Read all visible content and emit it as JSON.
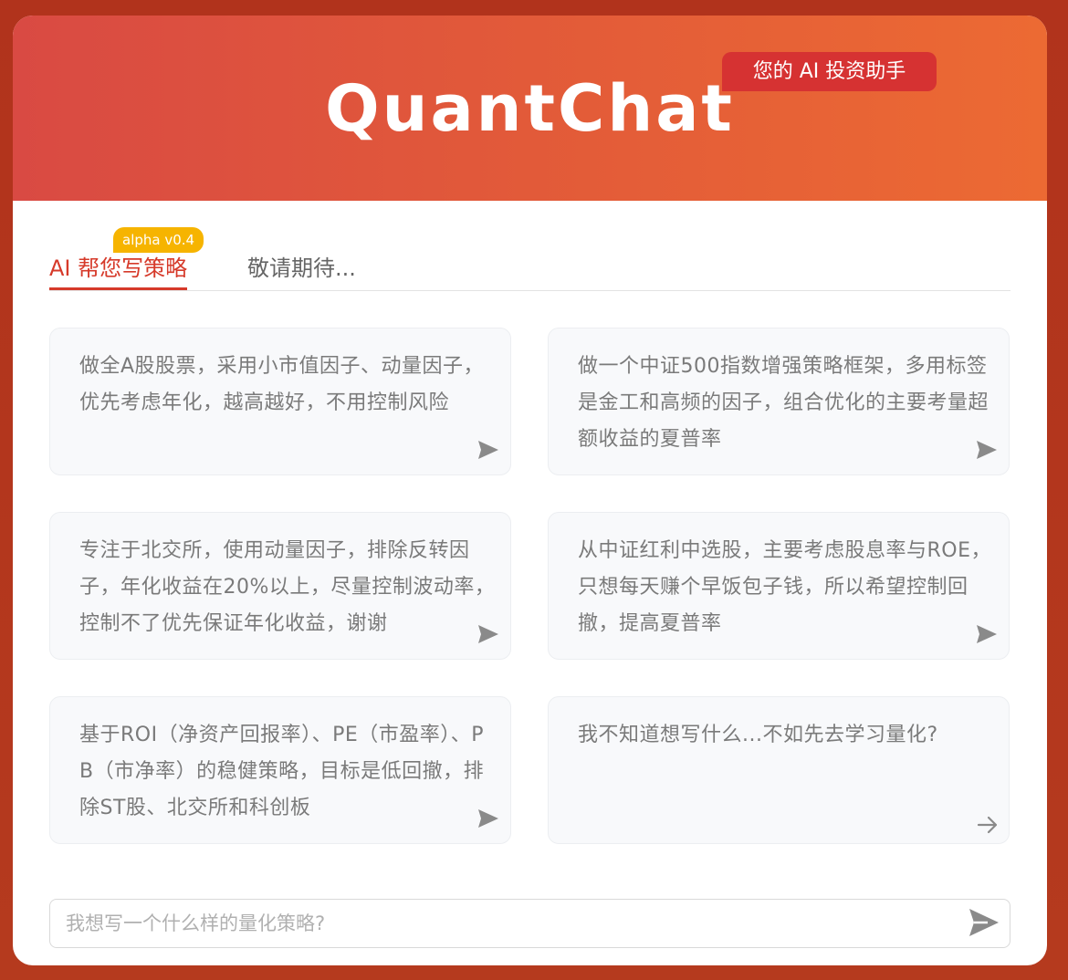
{
  "header": {
    "title": "QuantChat",
    "tagline": "您的 AI 投资助手"
  },
  "tabs": [
    {
      "label": "AI 帮您写策略",
      "badge": "alpha v0.4",
      "active": true
    },
    {
      "label": "敬请期待...",
      "active": false
    }
  ],
  "prompts": [
    {
      "text": "做全A股股票，采用小市值因子、动量因子，优先考虑年化，越高越好，不用控制风险",
      "icon": "send-icon"
    },
    {
      "text": "做一个中证500指数增强策略框架，多用标签是金工和高频的因子，组合优化的主要考量超额收益的夏普率",
      "icon": "send-icon"
    },
    {
      "text": "专注于北交所，使用动量因子，排除反转因子，年化收益在20%以上，尽量控制波动率，控制不了优先保证年化收益，谢谢",
      "icon": "send-icon"
    },
    {
      "text": "从中证红利中选股，主要考虑股息率与ROE，只想每天赚个早饭包子钱，所以希望控制回撤，提高夏普率",
      "icon": "send-icon"
    },
    {
      "text": "基于ROI（净资产回报率）、PE（市盈率）、PB（市净率）的稳健策略，目标是低回撤，排除ST股、北交所和科创板",
      "icon": "send-icon"
    },
    {
      "text": "我不知道想写什么...不如先去学习量化?",
      "icon": "arrow-right-icon"
    }
  ],
  "input": {
    "placeholder": "我想写一个什么样的量化策略?",
    "value": ""
  },
  "colors": {
    "accent": "#d63a2a",
    "badge": "#f6b400",
    "header_start": "#d94a43",
    "header_end": "#ec6a33"
  }
}
